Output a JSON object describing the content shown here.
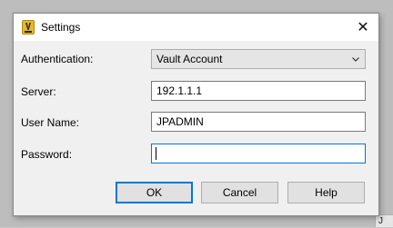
{
  "window": {
    "title": "Settings",
    "close_glyph": "✕"
  },
  "form": {
    "authentication": {
      "label": "Authentication:",
      "selected": "Vault Account"
    },
    "server": {
      "label": "Server:",
      "value": "192.1.1.1"
    },
    "user_name": {
      "label": "User Name:",
      "value": "JPADMIN"
    },
    "password": {
      "label": "Password:",
      "value": ""
    }
  },
  "buttons": {
    "ok": "OK",
    "cancel": "Cancel",
    "help": "Help"
  },
  "taskbar": {
    "label": "J"
  },
  "colors": {
    "accent": "#0078d7",
    "app_icon": "#e7b72c"
  },
  "icons": {
    "app": "vault-app-icon",
    "close": "close-icon",
    "dropdown": "chevron-down-icon"
  }
}
